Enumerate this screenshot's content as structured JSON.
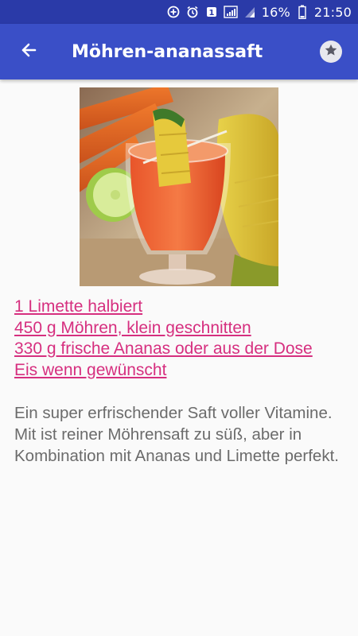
{
  "status_bar": {
    "battery_percent": "16%",
    "time": "21:50",
    "icons": [
      "data-saver-icon",
      "alarm-icon",
      "notification-icon",
      "signal-icon",
      "battery-icon"
    ]
  },
  "app_bar": {
    "title": "Möhren-ananassaft",
    "back_icon": "arrow-back-icon",
    "favorite_icon": "star-icon"
  },
  "recipe": {
    "image_alt": "Möhren-ananassaft",
    "ingredients": [
      "1 Limette halbiert",
      "450 g Möhren, klein geschnitten",
      "330 g frische Ananas oder aus der Dose",
      "Eis wenn gewünscht"
    ],
    "description": "Ein super erfrischender Saft voller Vitamine. Mit ist reiner Möhrensaft zu süß, aber in Kombination mit Ananas und Limette perfekt."
  },
  "colors": {
    "status_bar": "#2a3aa8",
    "app_bar": "#3a4fc7",
    "link": "#d62f7f",
    "body_text": "#6b6b6b",
    "background": "#fafafa"
  }
}
